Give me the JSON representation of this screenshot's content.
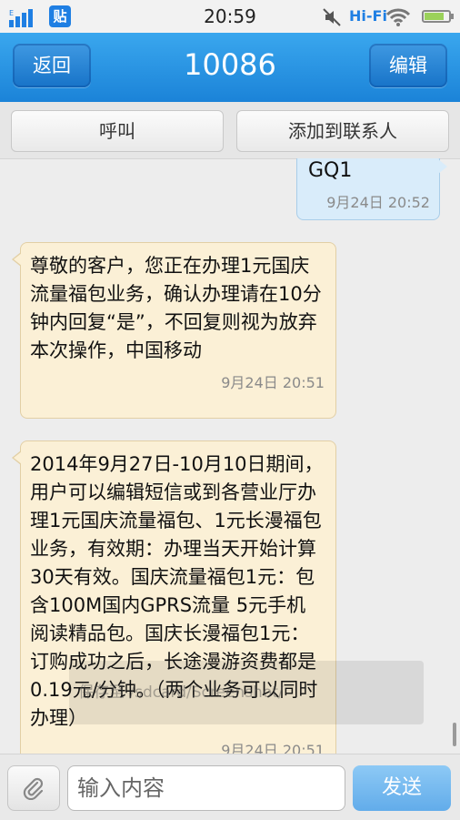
{
  "status_bar": {
    "time": "20:59",
    "hifi": "Hi-Fi",
    "tieba_label": "贴",
    "icons": [
      "signal-icon",
      "tieba-icon",
      "mute-icon",
      "wifi-icon",
      "battery-icon"
    ],
    "battery_level": 0.8
  },
  "header": {
    "back_label": "返回",
    "title": "10086",
    "edit_label": "编辑"
  },
  "actions": {
    "call_label": "呼叫",
    "add_contact_label": "添加到联系人"
  },
  "messages": [
    {
      "direction": "outgoing",
      "text": "GQ1",
      "time": "9月24日 20:52"
    },
    {
      "direction": "incoming",
      "text": "尊敬的客户，您正在办理1元国庆流量福包业务，确认办理请在10分钟内回复“是”，不回复则视为放弃本次操作，中国移动",
      "time": "9月24日 20:51"
    },
    {
      "direction": "incoming",
      "text": "2014年9月27日-10月10日期间，用户可以编辑短信或到各营业厅办理1元国庆流量福包、1元长漫福包业务，有效期：办理当天开始计算30天有效。国庆流量福包1元：包含100M国内GPRS流量 5元手机阅读精品包。国庆长漫福包1元：订购成功之后，长途漫游资费都是0.19元/分钟。（两个业务可以同时办理）",
      "time": "9月24日 20:51"
    }
  ],
  "toast": {
    "text": "保存至 /sdcard/Screenshot/"
  },
  "composer": {
    "placeholder": "输入内容",
    "send_label": "发送"
  },
  "colors": {
    "header_blue": "#1b83d8",
    "incoming_bubble": "#fbf0d6",
    "outgoing_bubble": "#d9ecfa",
    "send_button": "#62acea"
  }
}
